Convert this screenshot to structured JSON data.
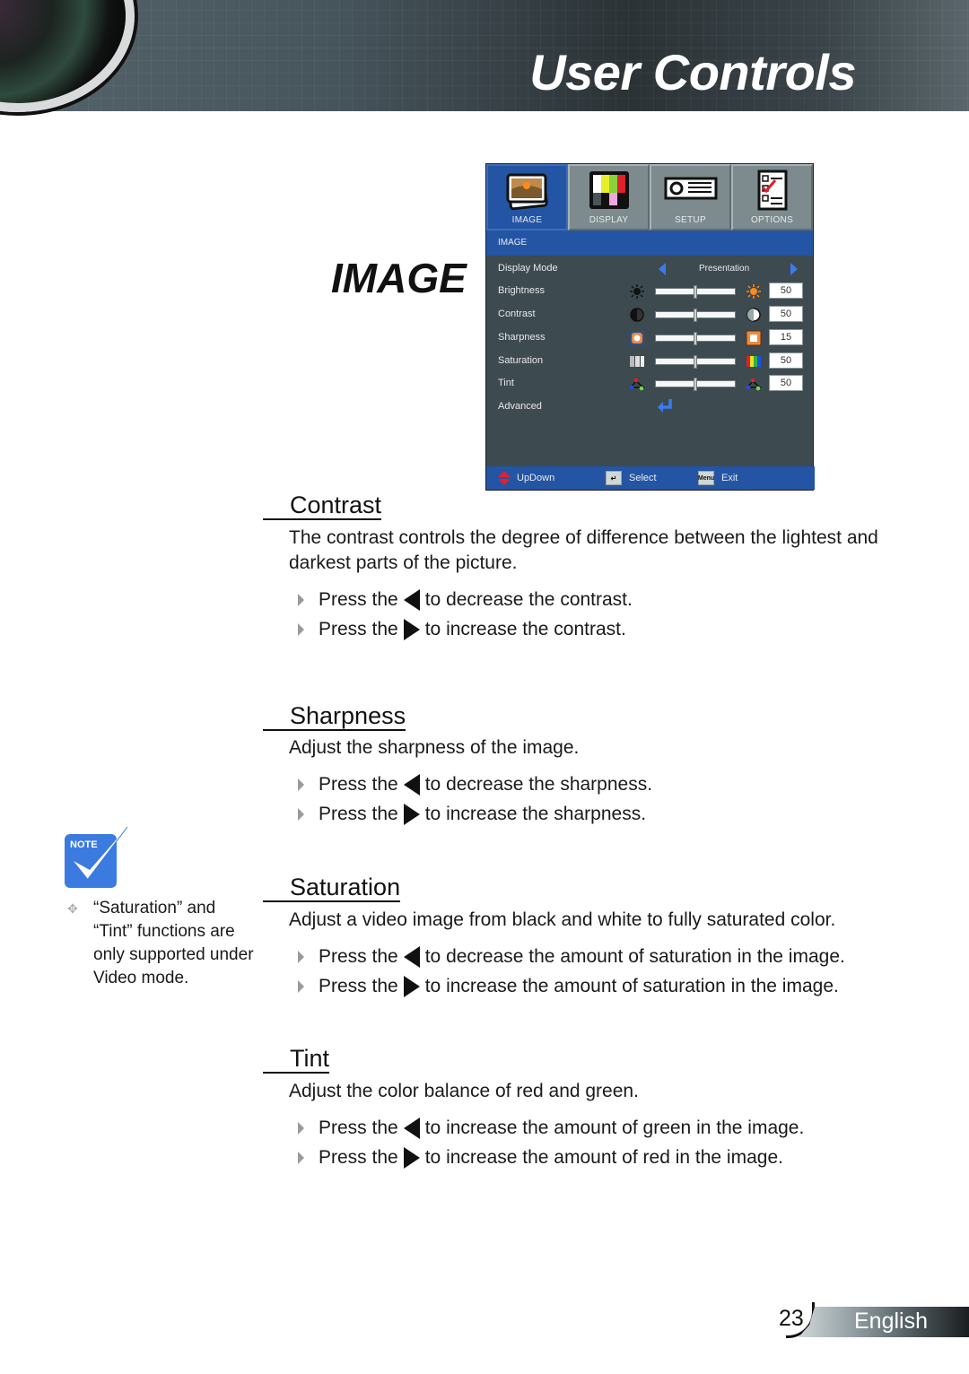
{
  "header": {
    "title": "User Controls"
  },
  "section_title": "IMAGE",
  "osd": {
    "tabs": [
      {
        "label": "IMAGE",
        "icon": "image-icon",
        "active": true
      },
      {
        "label": "DISPLAY",
        "icon": "color-bars-icon",
        "active": false
      },
      {
        "label": "SETUP",
        "icon": "projector-icon",
        "active": false
      },
      {
        "label": "OPTIONS",
        "icon": "checklist-icon",
        "active": false
      }
    ],
    "subheader": "IMAGE",
    "display_mode": {
      "label": "Display Mode",
      "value": "Presentation"
    },
    "rows": [
      {
        "label": "Brightness",
        "value": "50",
        "level": 50,
        "left_icon": "sun-dark-icon",
        "right_icon": "sun-orange-icon"
      },
      {
        "label": "Contrast",
        "value": "50",
        "level": 50,
        "left_icon": "contrast-dark-icon",
        "right_icon": "contrast-light-icon"
      },
      {
        "label": "Sharpness",
        "value": "15",
        "level": 50,
        "left_icon": "sharpness-soft-icon",
        "right_icon": "sharpness-sharp-icon"
      },
      {
        "label": "Saturation",
        "value": "50",
        "level": 50,
        "left_icon": "saturation-gray-icon",
        "right_icon": "saturation-color-icon"
      },
      {
        "label": "Tint",
        "value": "50",
        "level": 50,
        "left_icon": "tint-icon",
        "right_icon": "tint-icon"
      }
    ],
    "advanced": {
      "label": "Advanced",
      "icon": "enter-arrow-icon"
    },
    "footer": {
      "updown": "UpDown",
      "select": "Select",
      "menu_key": "Menu",
      "exit": "Exit"
    },
    "colors": {
      "accent_blue": "#2355a4",
      "panel": "#3d4a50",
      "arrow_blue": "#3a7bf0"
    }
  },
  "sections": [
    {
      "title": "Contrast",
      "description": "The contrast controls the degree of difference between the lightest and darkest parts of the picture.",
      "bullets": [
        {
          "prefix": "Press the",
          "key": "left",
          "text": "to decrease the contrast."
        },
        {
          "prefix": "Press the",
          "key": "right",
          "text": "to increase the contrast."
        }
      ]
    },
    {
      "title": "Sharpness",
      "description": "Adjust the sharpness of the image.",
      "bullets": [
        {
          "prefix": "Press the",
          "key": "left",
          "text": "to decrease the sharpness."
        },
        {
          "prefix": "Press the",
          "key": "right",
          "text": "to increase the sharpness."
        }
      ]
    },
    {
      "title": "Saturation",
      "description": "Adjust a video image from black and white to fully saturated color.",
      "bullets": [
        {
          "prefix": "Press the",
          "key": "left",
          "text": "to decrease the amount of saturation in the image."
        },
        {
          "prefix": "Press the",
          "key": "right",
          "text": "to increase the amount of saturation in the image."
        }
      ]
    },
    {
      "title": "Tint",
      "description": "Adjust the color balance of red and green.",
      "bullets": [
        {
          "prefix": "Press the",
          "key": "left",
          "text": "to increase the amount of green in the image."
        },
        {
          "prefix": "Press the",
          "key": "right",
          "text": "to increase the amount of red in the image."
        }
      ]
    }
  ],
  "note": {
    "badge": "NOTE",
    "text": "“Saturation” and “Tint” functions are only supported under Video mode."
  },
  "footer": {
    "page_number": "23",
    "language": "English"
  }
}
